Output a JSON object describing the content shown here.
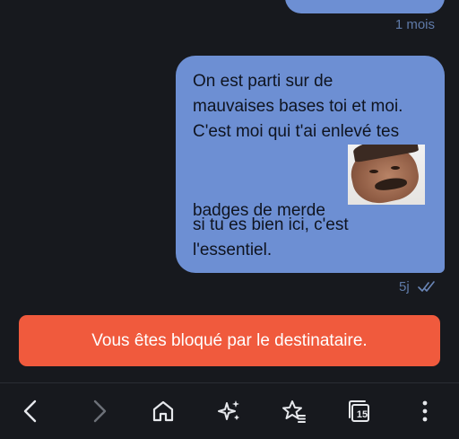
{
  "conversation": {
    "previous_message": {
      "timestamp": "1 mois"
    },
    "message": {
      "lines_before_sticker": [
        "On est parti sur de",
        "mauvaises bases toi et moi.",
        "C'est moi qui t'ai enlevé tes"
      ],
      "sticker_row_text": "badges de merde",
      "lines_after_sticker": [
        "si tu es bien ici, c'est",
        "l'essentiel."
      ],
      "sticker_icon": "man-meme-sticker",
      "timestamp": "5j",
      "read_status_icon": "double-check-icon"
    }
  },
  "blocked_notice": {
    "text": "Vous êtes bloqué par le destinataire.",
    "background_color": "#f05a3d"
  },
  "browser_toolbar": {
    "tab_count": "15",
    "buttons": [
      {
        "name": "back",
        "icon": "chevron-left-icon"
      },
      {
        "name": "forward",
        "icon": "chevron-right-icon"
      },
      {
        "name": "home",
        "icon": "home-icon"
      },
      {
        "name": "assistant",
        "icon": "sparkles-icon"
      },
      {
        "name": "favorites",
        "icon": "star-list-icon"
      },
      {
        "name": "tabs",
        "icon": "tabs-icon"
      },
      {
        "name": "menu",
        "icon": "kebab-menu-icon"
      }
    ]
  },
  "colors": {
    "background": "#17191e",
    "bubble": "#6d8fd3",
    "timestamp": "#5f7aa8"
  }
}
